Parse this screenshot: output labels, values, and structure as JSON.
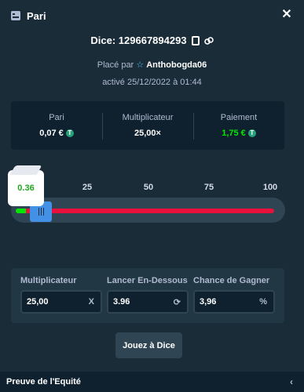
{
  "header": {
    "title": "Pari",
    "icon": "ticket-icon",
    "close_icon": "close-icon"
  },
  "bet": {
    "dice_label": "Dice: 129667894293",
    "placed_by_prefix": "Placé par",
    "username": "Anthobogda06",
    "activated": "activé 25/12/2022 à 01:44"
  },
  "stats": {
    "bet_label": "Pari",
    "bet_value": "0,07 €",
    "multiplier_label": "Multiplicateur",
    "multiplier_value": "25,00×",
    "payout_label": "Paiement",
    "payout_value": "1,75 €"
  },
  "slider": {
    "ticks": [
      "0",
      "25",
      "50",
      "75",
      "100"
    ],
    "result": "0.36",
    "target": 3.96,
    "range": [
      0,
      100
    ],
    "win_color": "#00e701",
    "lose_color": "#e9113c"
  },
  "controls": {
    "multiplier_label": "Multiplicateur",
    "multiplier_value": "25,00",
    "multiplier_suffix": "X",
    "roll_under_label": "Lancer En-Dessous",
    "roll_under_value": "3.96",
    "win_chance_label": "Chance de Gagner",
    "win_chance_value": "3,96",
    "win_chance_suffix": "%"
  },
  "play_button": "Jouez à Dice",
  "footer": {
    "title": "Preuve de l'Equité"
  }
}
